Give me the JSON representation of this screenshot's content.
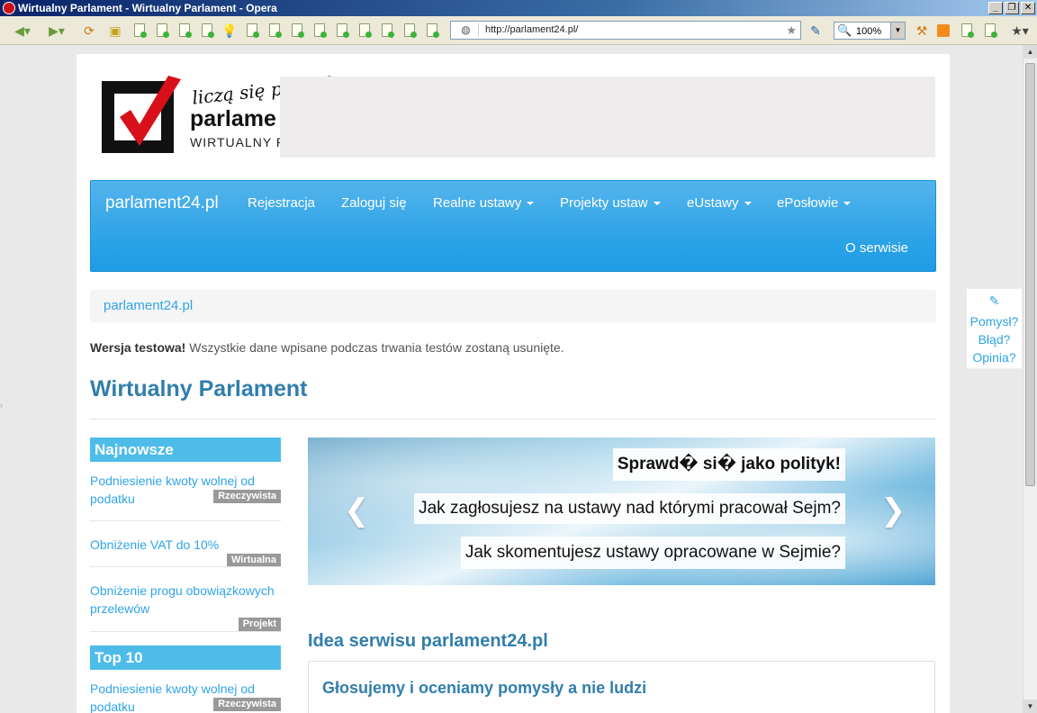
{
  "window": {
    "title": "Wirtualny Parlament - Wirtualny Parlament - Opera",
    "minimize": "_",
    "restore": "❐",
    "close": "✕"
  },
  "browser": {
    "url": "http://parlament24.pl/",
    "zoom": "100%"
  },
  "header": {
    "logo_tagline": "liczą się poglądy",
    "logo_name": "parlame",
    "logo_sub": "WIRTUALNY P"
  },
  "navbar": {
    "brand": "parlament24.pl",
    "items": [
      {
        "label": "Rejestracja",
        "dropdown": false
      },
      {
        "label": "Zaloguj się",
        "dropdown": false
      },
      {
        "label": "Realne ustawy",
        "dropdown": true
      },
      {
        "label": "Projekty ustaw",
        "dropdown": true
      },
      {
        "label": "eUstawy",
        "dropdown": true
      },
      {
        "label": "ePosłowie",
        "dropdown": true
      }
    ],
    "about": "O serwisie"
  },
  "breadcrumb": "parlament24.pl",
  "notice": {
    "bold": "Wersja testowa!",
    "text": " Wszystkie dane wpisane podczas trwania testów zostaną usunięte."
  },
  "page_title": "Wirtualny Parlament",
  "sidebar": {
    "newest_heading": "Najnowsze",
    "newest": [
      {
        "title": "Podniesienie kwoty wolnej od podatku",
        "badge": "Rzeczywista"
      },
      {
        "title": "Obniżenie VAT do 10%",
        "badge": "Wirtualna"
      },
      {
        "title": "Obniżenie progu obowiązkowych przelewów",
        "badge": "Projekt"
      }
    ],
    "top_heading": "Top 10",
    "top": [
      {
        "title": "Podniesienie kwoty wolnej od podatku",
        "badge": "Rzeczywista"
      }
    ]
  },
  "carousel": {
    "line1": "Sprawd� si� jako polityk!",
    "line2": "Jak zagłosujesz na ustawy nad którymi pracował Sejm?",
    "line3": "Jak skomentujesz ustawy opracowane w Sejmie?",
    "prev": "❮",
    "next": "❯"
  },
  "section_title": "Idea serwisu parlament24.pl",
  "panel_title": "Głosujemy i oceniamy pomysły a nie ludzi",
  "feedback": {
    "line1": "Pomysł?",
    "line2": "Błąd?",
    "line3": "Opinia?"
  },
  "colors": {
    "accent": "#2fa4e7",
    "heading": "#317eac",
    "sidebar_heading": "#4dbce9",
    "badge": "#999999"
  }
}
